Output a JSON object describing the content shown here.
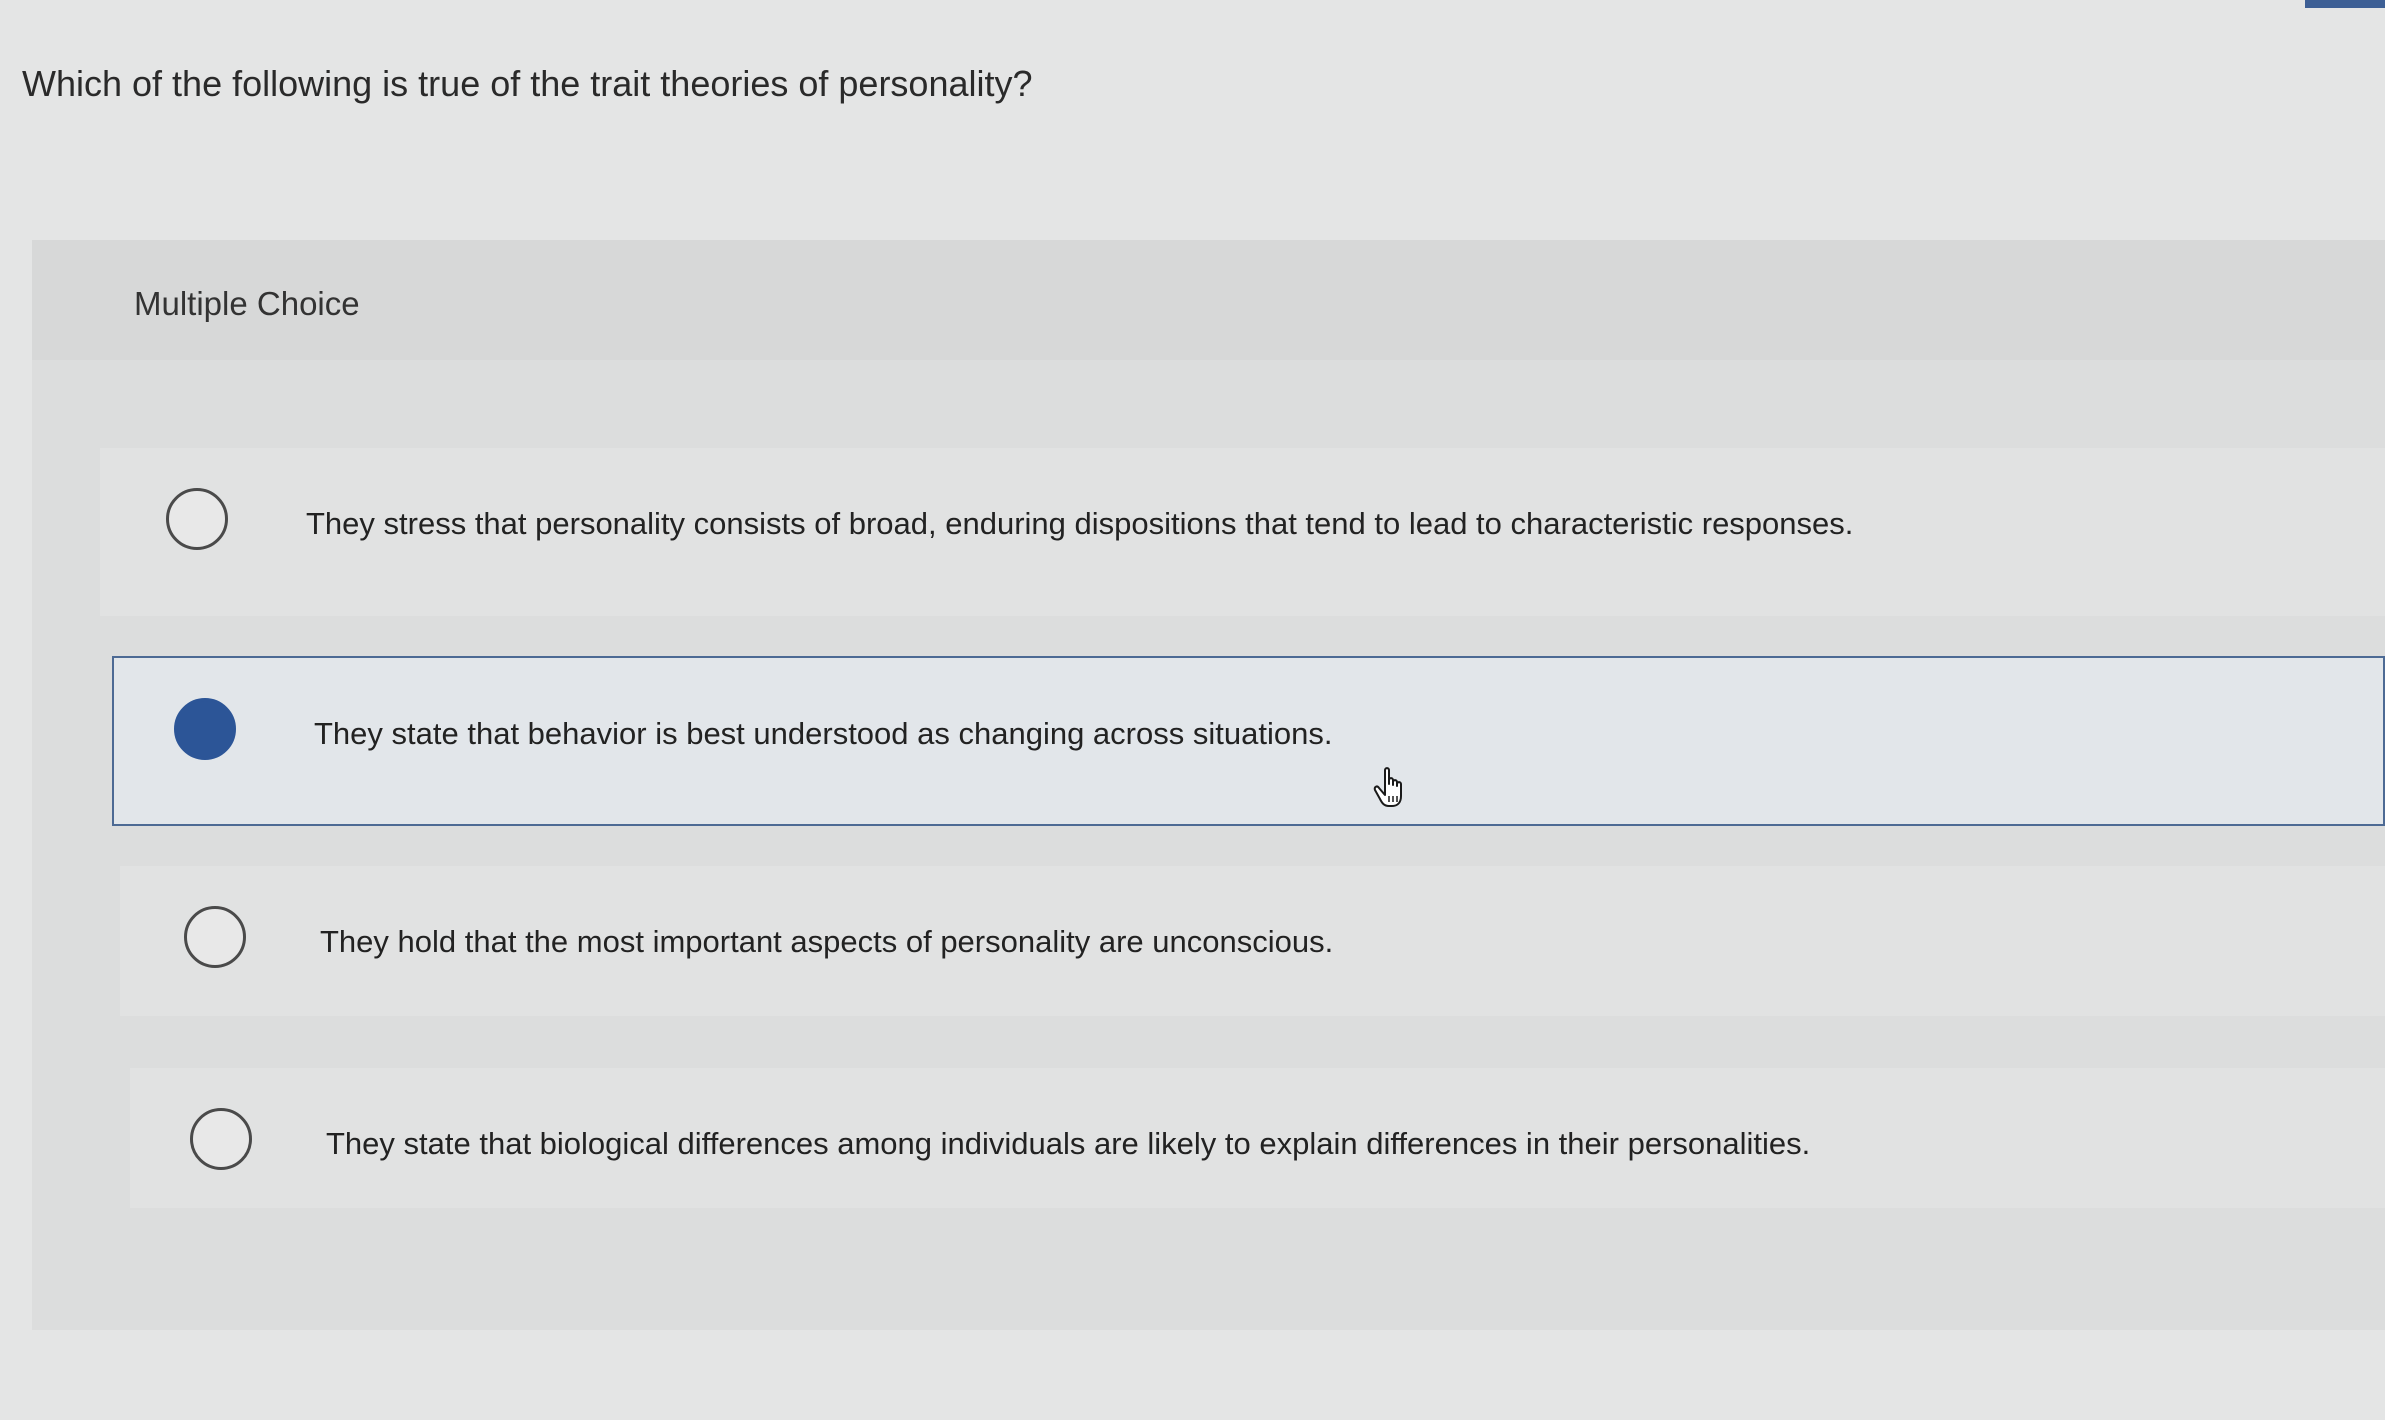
{
  "question": {
    "text": "Which of the following is true of the trait theories of personality?"
  },
  "panel": {
    "type_label": "Multiple Choice"
  },
  "options": [
    {
      "text": "They stress that personality consists of broad, enduring dispositions that tend to lead to characteristic responses.",
      "selected": false
    },
    {
      "text": "They state that behavior is best understood as changing across situations.",
      "selected": true
    },
    {
      "text": "They hold that the most important aspects of personality are unconscious.",
      "selected": false
    },
    {
      "text": "They state that biological differences among individuals are likely to explain differences in their personalities.",
      "selected": false
    }
  ],
  "colors": {
    "accent": "#2c5597",
    "selected_border": "#4d6a94",
    "background": "#e4e5e5"
  },
  "icons": {
    "pointer": "hand-pointer-icon"
  }
}
